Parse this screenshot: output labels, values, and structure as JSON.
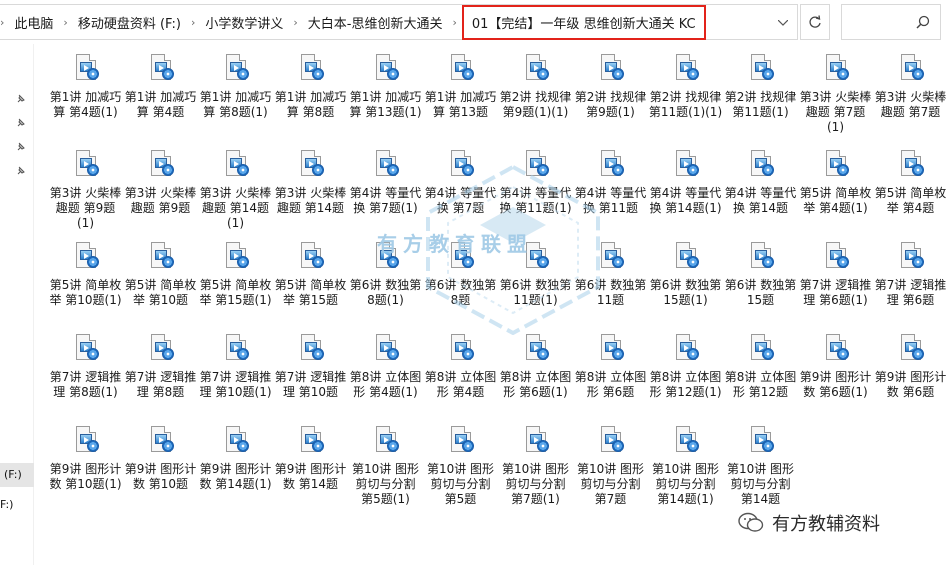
{
  "breadcrumbs": [
    "此电脑",
    "移动硬盘资料 (F:)",
    "小学数学讲义",
    "大白本-思维创新大通关"
  ],
  "current_folder": "01【完结】一年级 思维创新大通关 KC",
  "nav_pane": {
    "drive_label_1": "(F:)",
    "drive_label_2": "F:)"
  },
  "watermark_center": "有方教育联盟",
  "watermark_corner": "有方教辅资料",
  "files": [
    "第1讲 加减巧算 第4题(1)",
    "第1讲 加减巧算 第4题",
    "第1讲 加减巧算 第8题(1)",
    "第1讲 加减巧算 第8题",
    "第1讲 加减巧算 第13题(1)",
    "第1讲 加减巧算 第13题",
    "第2讲 找规律 第9题(1)(1)",
    "第2讲 找规律 第9题(1)",
    "第2讲 找规律 第11题(1)(1)",
    "第2讲 找规律 第11题(1)",
    "第3讲 火柴棒趣题 第7题(1)",
    "第3讲 火柴棒趣题 第7题",
    "第3讲 火柴棒趣题 第9题(1)",
    "第3讲 火柴棒趣题 第9题",
    "第3讲 火柴棒趣题 第14题(1)",
    "第3讲 火柴棒趣题 第14题",
    "第4讲 等量代换 第7题(1)",
    "第4讲 等量代换 第7题",
    "第4讲 等量代换 第11题(1)",
    "第4讲 等量代换 第11题",
    "第4讲 等量代换 第14题(1)",
    "第4讲 等量代换 第14题",
    "第5讲 简单枚举 第4题(1)",
    "第5讲 简单枚举 第4题",
    "第5讲 简单枚举 第10题(1)",
    "第5讲 简单枚举 第10题",
    "第5讲 简单枚举 第15题(1)",
    "第5讲 简单枚举 第15题",
    "第6讲 数独第8题(1)",
    "第6讲 数独第8题",
    "第6讲 数独第11题(1)",
    "第6讲 数独第11题",
    "第6讲 数独第15题(1)",
    "第6讲 数独第15题",
    "第7讲 逻辑推理 第6题(1)",
    "第7讲 逻辑推理 第6题",
    "第7讲 逻辑推理 第8题(1)",
    "第7讲 逻辑推理 第8题",
    "第7讲 逻辑推理 第10题(1)",
    "第7讲 逻辑推理 第10题",
    "第8讲 立体图形 第4题(1)",
    "第8讲 立体图形 第4题",
    "第8讲 立体图形 第6题(1)",
    "第8讲 立体图形 第6题",
    "第8讲 立体图形 第12题(1)",
    "第8讲 立体图形 第12题",
    "第9讲 图形计数 第6题(1)",
    "第9讲 图形计数 第6题",
    "第9讲 图形计数 第10题(1)",
    "第9讲 图形计数 第10题",
    "第9讲 图形计数 第14题(1)",
    "第9讲 图形计数 第14题",
    "第10讲 图形剪切与分割 第5题(1)",
    "第10讲 图形剪切与分割 第5题",
    "第10讲 图形剪切与分割 第7题(1)",
    "第10讲 图形剪切与分割 第7题",
    "第10讲 图形剪切与分割 第14题(1)",
    "第10讲 图形剪切与分割 第14题"
  ]
}
